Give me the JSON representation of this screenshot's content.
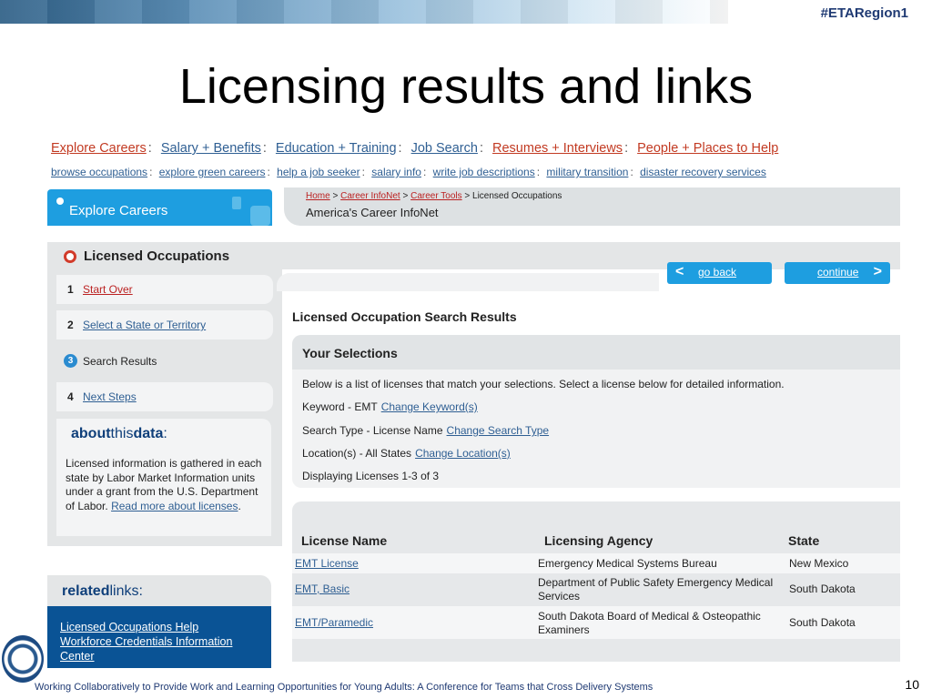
{
  "slide": {
    "hashtag": "#ETARegion1",
    "title": "Licensing results and links",
    "footer": "Working Collaboratively to Provide Work and Learning Opportunities for Young Adults: A Conference for Teams that Cross Delivery Systems",
    "page_number": "10"
  },
  "nav_main": [
    "Explore Careers",
    "Salary + Benefits",
    "Education + Training",
    "Job Search",
    "Resumes + Interviews",
    "People + Places to Help"
  ],
  "nav_sub": [
    "browse occupations",
    "explore green careers",
    "help a job seeker",
    "salary info",
    "write job descriptions",
    "military transition",
    "disaster recovery services"
  ],
  "separator": ":",
  "explore_tab": "Explore Careers",
  "breadcrumb": {
    "home": "Home",
    "infonet": "Career InfoNet",
    "tools": "Career Tools",
    "current": "Licensed Occupations",
    "gt": ">"
  },
  "page_subtitle": "America's Career InfoNet",
  "licensed_title": "Licensed Occupations",
  "steps": [
    {
      "num": "1",
      "label": "Start Over"
    },
    {
      "num": "2",
      "label": "Select a State or Territory"
    },
    {
      "num": "3",
      "label": "Search Results"
    },
    {
      "num": "4",
      "label": "Next Steps"
    }
  ],
  "about": {
    "title_bold": "about",
    "title_rest": "this",
    "title_bold2": "data",
    "colon": ":",
    "text": "Licensed information is gathered in each state by Labor Market Information units under a grant from the U.S. Department of Labor.",
    "link": "Read more about licenses",
    "end": "."
  },
  "related": {
    "title_bold": "related",
    "title_rest": "links:",
    "links": [
      "Licensed Occupations Help",
      "Workforce Credentials Information",
      "Center"
    ]
  },
  "buttons": {
    "go_back": "go back",
    "continue": "continue",
    "back_arrow": "<",
    "next_arrow": ">"
  },
  "results_heading": "Licensed Occupation Search Results",
  "selections": {
    "title": "Your Selections",
    "intro": "Below is a list of licenses that match your selections. Select a license below for detailed information.",
    "keyword": "Keyword - EMT",
    "keyword_link": "Change Keyword(s)",
    "search_type": "Search Type - License Name",
    "search_type_link": "Change Search Type",
    "location": "Location(s) - All States",
    "location_link": "Change Location(s)",
    "displaying": "Displaying Licenses 1-3 of 3"
  },
  "table": {
    "headers": [
      "License Name",
      "Licensing Agency",
      "State"
    ],
    "rows": [
      {
        "name": "EMT License",
        "agency": "Emergency Medical Systems Bureau",
        "state": "New Mexico"
      },
      {
        "name": "EMT, Basic",
        "agency": "Department of Public Safety Emergency Medical Services",
        "state": "South Dakota"
      },
      {
        "name": "EMT/Paramedic",
        "agency": "South Dakota Board of Medical & Osteopathic Examiners",
        "state": "South Dakota"
      }
    ]
  },
  "colors": {
    "accent_blue": "#1e9ee0",
    "link_blue": "#2f5f93",
    "link_red": "#c23a22",
    "dark_blue": "#0a5395"
  }
}
